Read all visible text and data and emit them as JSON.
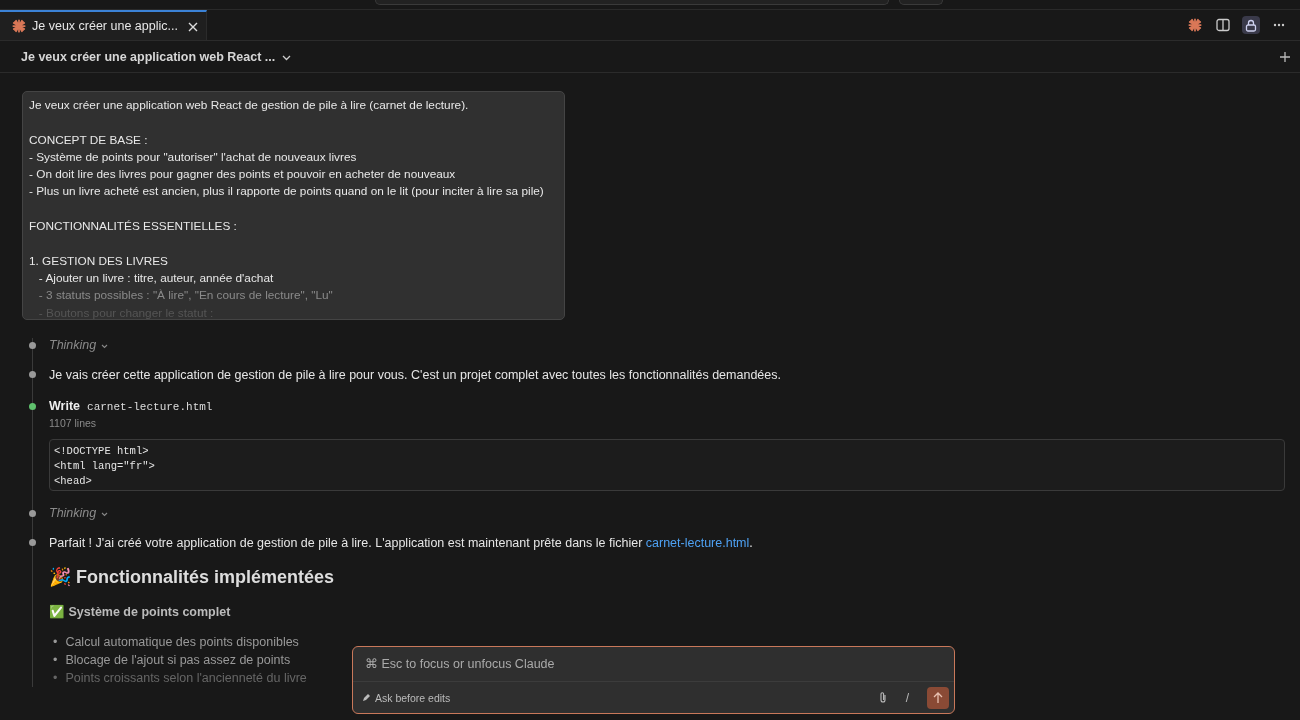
{
  "tabs": [
    {
      "label": "Je veux créer une applic...",
      "selected": true
    }
  ],
  "header": {
    "title": "Je veux créer une application web React ..."
  },
  "prompt_card": {
    "paragraphs": [
      [
        "Je veux créer une application web React de gestion de pile à lire (carnet de lecture)."
      ],
      [
        "CONCEPT DE BASE :",
        "- Système de points pour \"autoriser\" l'achat de nouveaux livres",
        "- On doit lire des livres pour gagner des points et pouvoir en acheter de nouveaux",
        "- Plus un livre acheté est ancien, plus il rapporte de points quand on le lit (pour inciter à lire sa pile)"
      ],
      [
        "FONCTIONNALITÉS ESSENTIELLES :"
      ],
      [
        "1. GESTION DES LIVRES",
        "   - Ajouter un livre : titre, auteur, année d'achat",
        "   - 3 statuts possibles : \"À lire\", \"En cours de lecture\", \"Lu\"",
        "   - Boutons pour changer le statut :"
      ]
    ]
  },
  "timeline": [
    {
      "kind": "thinking",
      "label": "Thinking"
    },
    {
      "kind": "message",
      "text": "Je vais créer cette application de gestion de pile à lire pour vous. C'est un projet complet avec toutes les fonctionnalités demandées."
    },
    {
      "kind": "write",
      "action": "Write",
      "file": "carnet-lecture.html",
      "meta": "1107 lines",
      "code": [
        "<!DOCTYPE html>",
        "<html lang=\"fr\">",
        "<head>"
      ]
    },
    {
      "kind": "thinking",
      "label": "Thinking"
    },
    {
      "kind": "message",
      "text": "Parfait ! J'ai créé votre application de gestion de pile à lire. L'application est maintenant prête dans le fichier ",
      "link": "carnet-lecture.html",
      "after": ".",
      "heading": "🎉 Fonctionnalités implémentées",
      "subheading": "✅ Système de points complet",
      "bullets": [
        {
          "marker": "•",
          "text": "Calcul automatique des points disponibles"
        },
        {
          "marker": "•",
          "text": "Blocage de l'ajout si pas assez de points"
        },
        {
          "marker": "•",
          "text": "Points croissants selon l'ancienneté du livre"
        }
      ]
    }
  ],
  "composer": {
    "placeholder": "⌘ Esc to focus or unfocus Claude",
    "mode": "Ask before edits",
    "slash": "/"
  }
}
